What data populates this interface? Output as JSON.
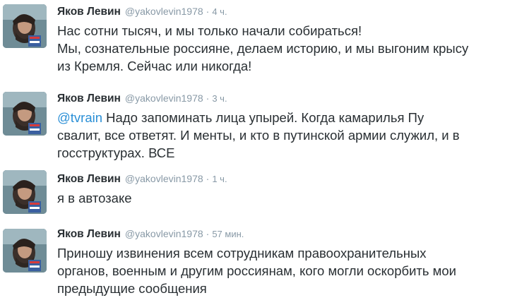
{
  "tweets": [
    {
      "name": "Яков Левин",
      "handle": "@yakovlevin1978",
      "separator": "·",
      "time": "4 ч.",
      "lines": [
        "Нас сотни тысяч, и мы только начали собираться!",
        "Мы, сознательные россияне, делаем историю, и мы выгоним крысу",
        "из Кремля. Сейчас или никогда!"
      ]
    },
    {
      "name": "Яков Левин",
      "handle": "@yakovlevin1978",
      "separator": "·",
      "time": "3 ч.",
      "mention": "@tvrain",
      "lines": [
        " Надо запоминать лица упырей. Когда камарилья Пу",
        "свалит, все ответят. И менты, и кто в путинской армии служил, и в",
        "госструктурах. ВСЕ"
      ]
    },
    {
      "name": "Яков Левин",
      "handle": "@yakovlevin1978",
      "separator": "·",
      "time": "1 ч.",
      "lines": [
        "я в автозаке"
      ]
    },
    {
      "name": "Яков Левин",
      "handle": "@yakovlevin1978",
      "separator": "·",
      "time": "57 мин.",
      "lines": [
        "Приношу извинения всем сотрудникам правоохранительных",
        "органов, военным и другим россиянам, кого могли оскорбить мои",
        "предыдущие сообщения"
      ]
    }
  ],
  "avatar_icon": "profile-photo-icon",
  "colors": {
    "text": "#292f33",
    "meta": "#8899a6",
    "link": "#2a8fd6"
  }
}
